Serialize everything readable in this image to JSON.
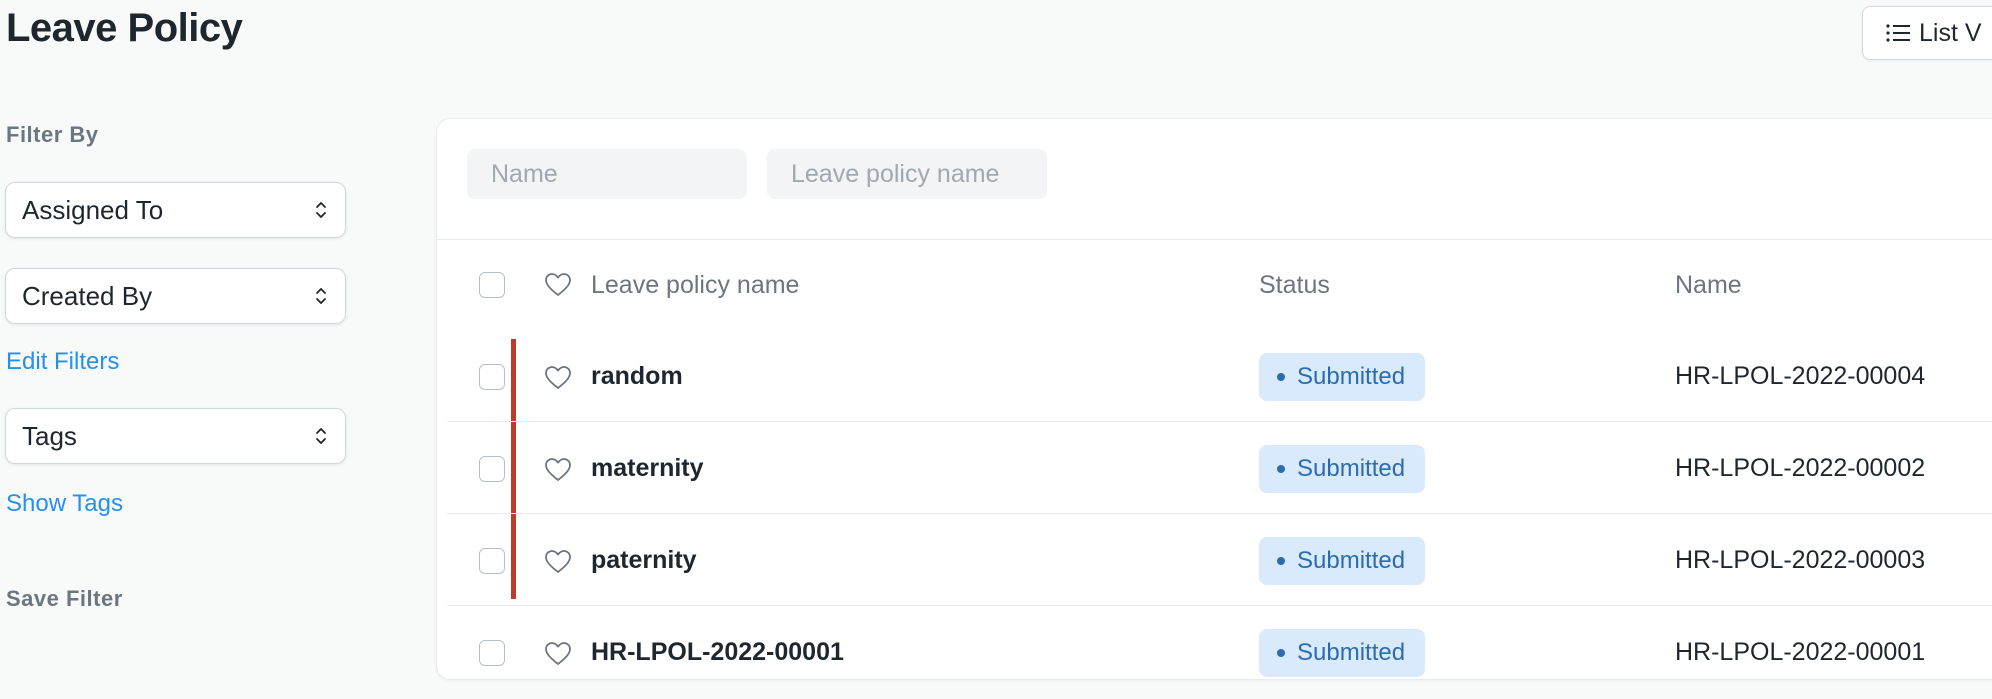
{
  "page": {
    "title": "Leave Policy",
    "view_button_label": "List V"
  },
  "sidebar": {
    "filter_by_label": "Filter By",
    "assigned_to_label": "Assigned To",
    "created_by_label": "Created By",
    "edit_filters_label": "Edit Filters",
    "tags_label": "Tags",
    "show_tags_label": "Show Tags",
    "save_filter_label": "Save Filter"
  },
  "filters": {
    "name_placeholder": "Name",
    "leave_policy_name_placeholder": "Leave policy name"
  },
  "table": {
    "columns": [
      "Leave policy name",
      "Status",
      "Name"
    ],
    "rows": [
      {
        "name": "random",
        "status": "Submitted",
        "id": "HR-LPOL-2022-00004"
      },
      {
        "name": "maternity",
        "status": "Submitted",
        "id": "HR-LPOL-2022-00002"
      },
      {
        "name": "paternity",
        "status": "Submitted",
        "id": "HR-LPOL-2022-00003"
      },
      {
        "name": "HR-LPOL-2022-00001",
        "status": "Submitted",
        "id": "HR-LPOL-2022-00001"
      }
    ]
  },
  "colors": {
    "accent": "#2490ef",
    "badge_bg": "#d9eafc",
    "badge_text": "#2b6cb0",
    "indicator": "#c0392b"
  }
}
